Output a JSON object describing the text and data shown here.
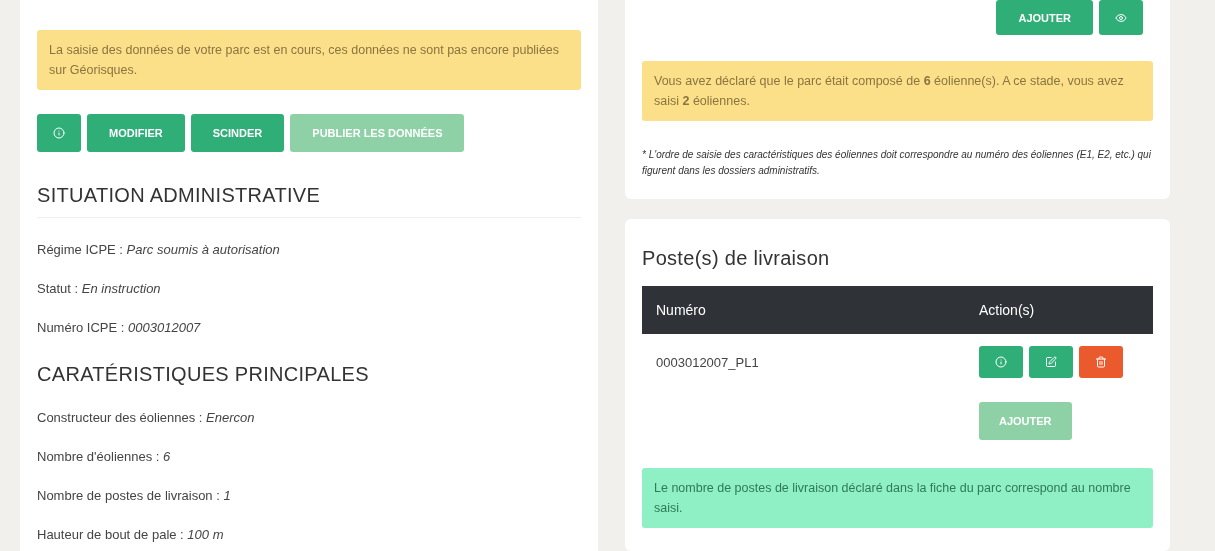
{
  "left_panel": {
    "alert": "La saisie des données de votre parc est en cours, ces données ne sont pas encore publiées sur Géorisques.",
    "buttons": [
      {
        "kind": "info",
        "disabled": false
      },
      {
        "kind": "text",
        "label": "MODIFIER",
        "disabled": false
      },
      {
        "kind": "text",
        "label": "SCINDER",
        "disabled": false
      },
      {
        "kind": "text",
        "label": "PUBLIER LES DONNÉES",
        "disabled": true
      }
    ],
    "sections": [
      {
        "title": "SITUATION ADMINISTRATIVE",
        "ruled": true,
        "fields": [
          {
            "label": "Régime ICPE :",
            "value": "Parc soumis à autorisation"
          },
          {
            "label": "Statut :",
            "value": "En instruction"
          },
          {
            "label": "Numéro ICPE :",
            "value": "0003012007"
          }
        ]
      },
      {
        "title": "CARATÉRISTIQUES PRINCIPALES",
        "ruled": false,
        "fields": [
          {
            "label": "Constructeur des éoliennes :",
            "value": "Enercon"
          },
          {
            "label": "Nombre d'éoliennes :",
            "value": "6"
          },
          {
            "label": "Nombre de postes de livraison :",
            "value": "1"
          },
          {
            "label": "Hauteur de bout de pale :",
            "value": "100 m"
          }
        ]
      }
    ]
  },
  "turbines_panel": {
    "buttons": [
      {
        "kind": "text",
        "label": "AJOUTER",
        "disabled": false
      },
      {
        "kind": "view",
        "disabled": false
      }
    ],
    "alert": "Vous avez déclaré que le parc était composé de **6** éolienne(s). A ce stade, vous avez saisi **2** éoliennes.",
    "footnote": "* L'ordre de saisie des caractéristiques des éoliennes doit correspondre au numéro des éoliennes (E1, E2, etc.) qui figurent dans les dossiers administratifs."
  },
  "delivery_panel": {
    "title": "Poste(s) de livraison",
    "table": {
      "columns": [
        "Numéro",
        "Action(s)"
      ],
      "rows": [
        {
          "number": "0003012007_PL1",
          "actions": [
            {
              "kind": "info",
              "disabled": false
            },
            {
              "kind": "edit",
              "disabled": false
            },
            {
              "kind": "delete",
              "disabled": false
            }
          ]
        }
      ]
    },
    "add_button": {
      "label": "AJOUTER",
      "disabled": true
    },
    "alert": "Le nombre de postes de livraison déclaré dans la fiche du parc correspond au nombre saisi."
  }
}
